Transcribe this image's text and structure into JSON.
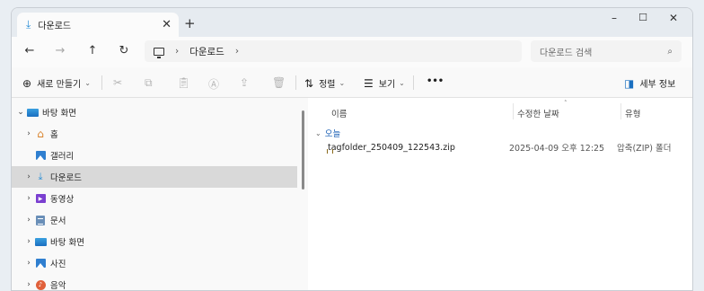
{
  "tab": {
    "title": "다운로드",
    "icon": "download-icon"
  },
  "window_controls": {
    "minimize": "–",
    "maximize": "☐",
    "close": "✕",
    "new_tab": "+",
    "tab_close": "✕"
  },
  "nav": {
    "back": "←",
    "forward": "→",
    "up": "↑",
    "refresh": "↻"
  },
  "address": {
    "segments": [
      "다운로드"
    ],
    "sep": "›"
  },
  "search": {
    "placeholder": "다운로드 검색",
    "icon": "🔍"
  },
  "toolbar": {
    "new": "새로 만들기",
    "sort": "정렬",
    "view": "보기",
    "more": "•••",
    "details": "세부 정보"
  },
  "tree": [
    {
      "label": "바탕 화면",
      "expanded": true
    },
    {
      "label": "홈"
    },
    {
      "label": "갤러리"
    },
    {
      "label": "다운로드",
      "selected": true
    },
    {
      "label": "동영상"
    },
    {
      "label": "문서"
    },
    {
      "label": "바탕 화면"
    },
    {
      "label": "사진"
    },
    {
      "label": "음악"
    }
  ],
  "columns": {
    "name": "이름",
    "modified": "수정한 날짜",
    "type": "유형"
  },
  "group": {
    "label": "오늘"
  },
  "files": [
    {
      "name": "tagfolder_250409_122543.zip",
      "modified": "2025-04-09 오후 12:25",
      "type": "압축(ZIP) 폴더"
    }
  ],
  "colors": {
    "accent": "#2b8fd6",
    "selected": "#d9d9d9"
  }
}
